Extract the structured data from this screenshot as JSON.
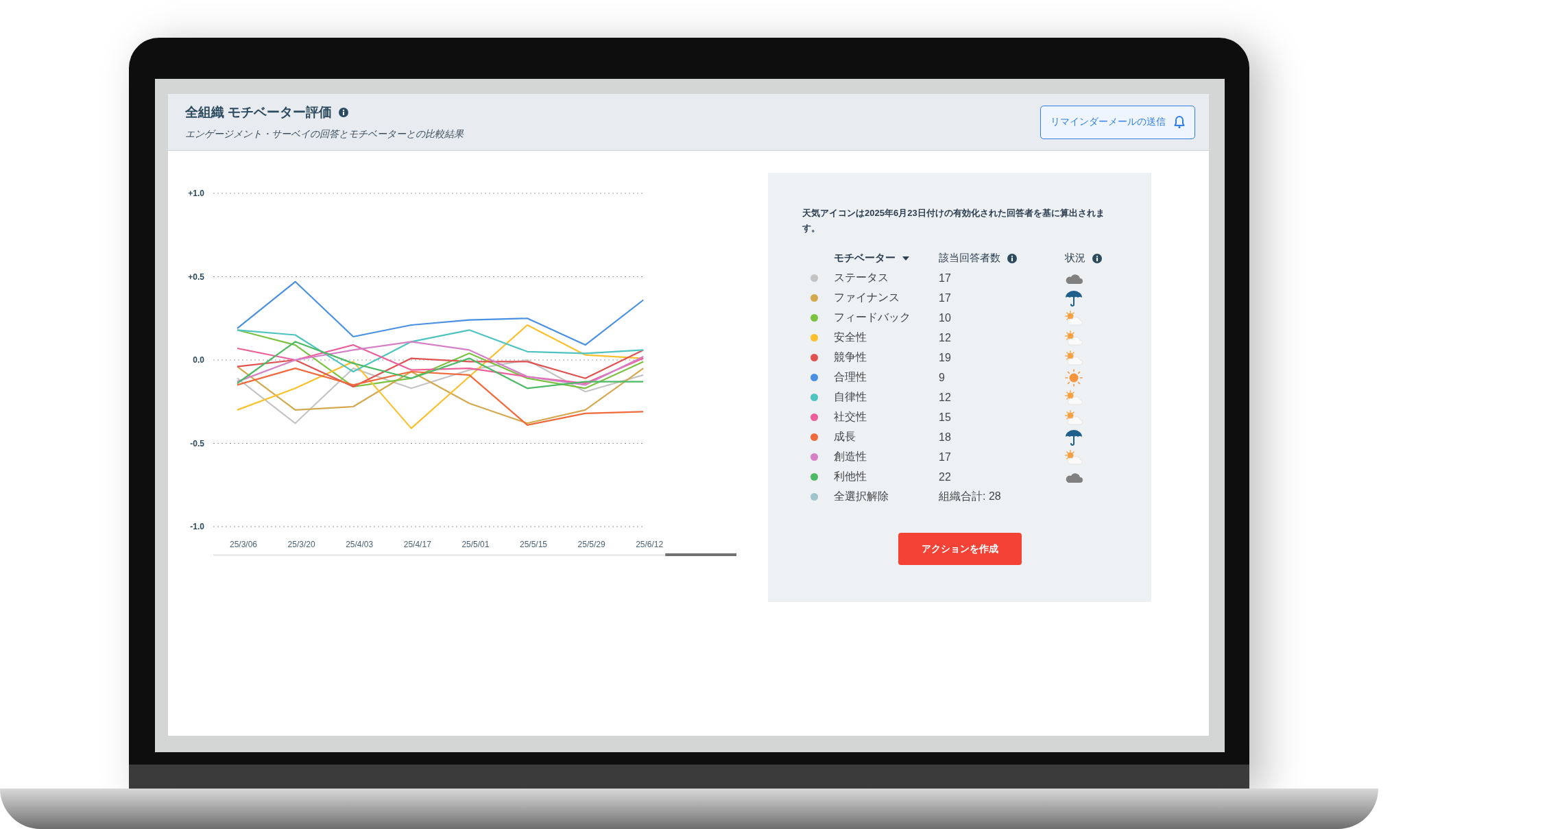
{
  "header": {
    "title": "全組織 モチベーター評価",
    "subtitle": "エンゲージメント・サーベイの回答とモチベーターとの比較結果",
    "reminder_button": "リマインダーメールの送信"
  },
  "chart": {
    "chart_data": {
      "type": "line",
      "categories": [
        "25/3/06",
        "25/3/20",
        "25/4/03",
        "25/4/17",
        "25/5/01",
        "25/5/15",
        "25/5/29",
        "25/6/12"
      ],
      "ylim": [
        -1,
        1
      ],
      "grid": true,
      "yticks": [
        {
          "value": 1,
          "label": "+1.0"
        },
        {
          "value": 0.5,
          "label": "+0.5"
        },
        {
          "value": 0,
          "label": "0.0"
        },
        {
          "value": -0.5,
          "label": "-0.5"
        },
        {
          "value": -1,
          "label": "-1.0"
        }
      ],
      "series": [
        {
          "name": "ステータス",
          "color": "#c4c4c4",
          "values": [
            -0.11,
            -0.38,
            -0.05,
            -0.17,
            -0.06,
            0.0,
            -0.19,
            -0.09
          ]
        },
        {
          "name": "ファイナンス",
          "color": "#d4a84f",
          "values": [
            -0.04,
            -0.3,
            -0.28,
            -0.07,
            -0.26,
            -0.38,
            -0.3,
            -0.05
          ]
        },
        {
          "name": "フィードバック",
          "color": "#7cc242",
          "values": [
            0.18,
            0.09,
            -0.16,
            -0.11,
            0.04,
            -0.11,
            -0.17,
            -0.01
          ]
        },
        {
          "name": "安全性",
          "color": "#fbc02d",
          "values": [
            -0.3,
            -0.17,
            -0.01,
            -0.41,
            -0.1,
            0.21,
            0.03,
            0.01
          ]
        },
        {
          "name": "競争性",
          "color": "#e05252",
          "values": [
            -0.04,
            0.0,
            -0.16,
            0.01,
            -0.01,
            -0.01,
            -0.11,
            0.06
          ]
        },
        {
          "name": "合理性",
          "color": "#4a90e2",
          "values": [
            0.19,
            0.47,
            0.14,
            0.21,
            0.24,
            0.25,
            0.09,
            0.36
          ]
        },
        {
          "name": "自律性",
          "color": "#4fc3c0",
          "values": [
            0.18,
            0.15,
            -0.07,
            0.11,
            0.18,
            0.05,
            0.04,
            0.06
          ]
        },
        {
          "name": "社交性",
          "color": "#ec5f9a",
          "values": [
            0.07,
            0.0,
            0.09,
            -0.06,
            -0.05,
            -0.1,
            -0.14,
            0.01
          ]
        },
        {
          "name": "成長",
          "color": "#f06a3b",
          "values": [
            -0.15,
            -0.05,
            -0.15,
            -0.07,
            -0.09,
            -0.39,
            -0.32,
            -0.31
          ]
        },
        {
          "name": "創造性",
          "color": "#d47fc6",
          "values": [
            -0.13,
            0.0,
            0.06,
            0.11,
            0.06,
            -0.1,
            -0.15,
            0.02
          ]
        },
        {
          "name": "利他性",
          "color": "#4cba64",
          "values": [
            -0.14,
            0.11,
            -0.02,
            -0.11,
            0.01,
            -0.17,
            -0.13,
            -0.13
          ]
        }
      ]
    }
  },
  "legend": {
    "note": "天気アイコンは2025年6月23日付けの有効化された回答者を基に算出されます。",
    "columns": [
      "モチベーター",
      "該当回答者数",
      "状況"
    ],
    "rows": [
      {
        "count": "17",
        "kind": "cloud"
      },
      {
        "count": "17",
        "kind": "umbrella"
      },
      {
        "count": "10",
        "kind": "partly_sunny"
      },
      {
        "count": "12",
        "kind": "partly_sunny"
      },
      {
        "count": "19",
        "kind": "partly_sunny"
      },
      {
        "count": "9",
        "kind": "sunny"
      },
      {
        "count": "12",
        "kind": "partly_sunny"
      },
      {
        "count": "15",
        "kind": "partly_sunny"
      },
      {
        "count": "18",
        "kind": "umbrella"
      },
      {
        "count": "17",
        "kind": "partly_sunny"
      },
      {
        "count": "22",
        "kind": "cloud"
      }
    ],
    "footer": {
      "label": "全選択解除",
      "total": "組織合計: 28",
      "color": "#9fc5cc"
    }
  },
  "action_button": "アクションを作成"
}
